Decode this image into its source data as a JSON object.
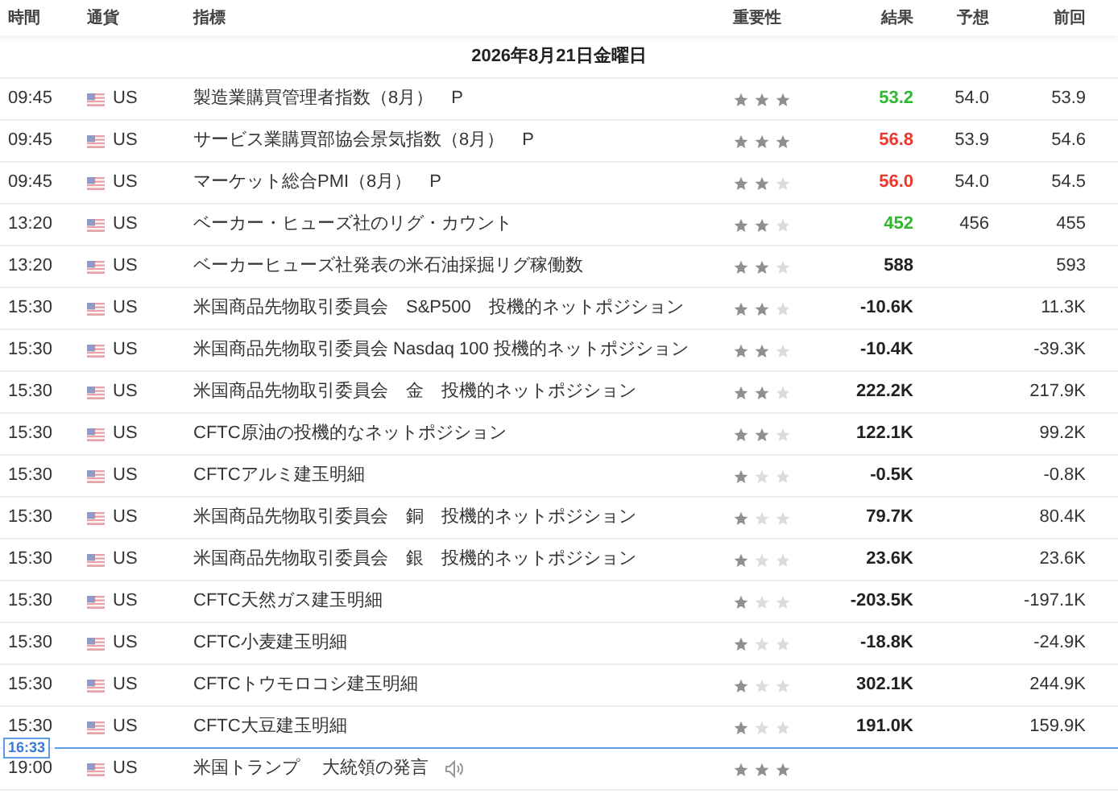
{
  "columns": [
    "時間",
    "通貨",
    "指標",
    "重要性",
    "結果",
    "予想",
    "前回"
  ],
  "date_heading": "2026年8月21日金曜日",
  "rows": [
    {
      "kind": "event",
      "time": "09:45",
      "currency": "US",
      "indicator": "製造業購買管理者指数（8月）　P",
      "stars": 3,
      "actual": "53.2",
      "color": "#2eb82e",
      "forecast": "54.0",
      "previous": "53.9",
      "speech": false
    },
    {
      "kind": "event",
      "time": "09:45",
      "currency": "US",
      "indicator": "サービス業購買部協会景気指数（8月）　P",
      "stars": 3,
      "actual": "56.8",
      "color": "#f0352b",
      "forecast": "53.9",
      "previous": "54.6",
      "speech": false
    },
    {
      "kind": "event",
      "time": "09:45",
      "currency": "US",
      "indicator": "マーケット総合PMI（8月）　P",
      "stars": 2,
      "actual": "56.0",
      "color": "#f0352b",
      "forecast": "54.0",
      "previous": "54.5",
      "speech": false
    },
    {
      "kind": "event",
      "time": "13:20",
      "currency": "US",
      "indicator": "ベーカー・ヒューズ社のリグ・カウント",
      "stars": 2,
      "actual": "452",
      "color": "#2eb82e",
      "forecast": "456",
      "previous": "455",
      "speech": false
    },
    {
      "kind": "event",
      "time": "13:20",
      "currency": "US",
      "indicator": "ベーカーヒューズ社発表の米石油採掘リグ稼働数",
      "stars": 2,
      "actual": "588",
      "color": "#222222",
      "previous": "593",
      "speech": false
    },
    {
      "kind": "event",
      "time": "15:30",
      "currency": "US",
      "indicator": "米国商品先物取引委員会　S&P500　投機的ネットポジション",
      "stars": 2,
      "actual": "-10.6K",
      "color": "#222222",
      "previous": "11.3K",
      "speech": false
    },
    {
      "kind": "event",
      "time": "15:30",
      "currency": "US",
      "indicator": "米国商品先物取引委員会 Nasdaq 100 投機的ネットポジション",
      "stars": 2,
      "actual": "-10.4K",
      "color": "#222222",
      "previous": "-39.3K",
      "speech": false
    },
    {
      "kind": "event",
      "time": "15:30",
      "currency": "US",
      "indicator": "米国商品先物取引委員会　金　投機的ネットポジション",
      "stars": 2,
      "actual": "222.2K",
      "color": "#222222",
      "previous": "217.9K",
      "speech": false
    },
    {
      "kind": "event",
      "time": "15:30",
      "currency": "US",
      "indicator": "CFTC原油の投機的なネットポジション",
      "stars": 2,
      "actual": "122.1K",
      "color": "#222222",
      "previous": "99.2K",
      "speech": false
    },
    {
      "kind": "event",
      "time": "15:30",
      "currency": "US",
      "indicator": "CFTCアルミ建玉明細",
      "stars": 1,
      "actual": "-0.5K",
      "color": "#222222",
      "previous": "-0.8K",
      "speech": false
    },
    {
      "kind": "event",
      "time": "15:30",
      "currency": "US",
      "indicator": "米国商品先物取引委員会　銅　投機的ネットポジション",
      "stars": 1,
      "actual": "79.7K",
      "color": "#222222",
      "previous": "80.4K",
      "speech": false
    },
    {
      "kind": "event",
      "time": "15:30",
      "currency": "US",
      "indicator": "米国商品先物取引委員会　銀　投機的ネットポジション",
      "stars": 1,
      "actual": "23.6K",
      "color": "#222222",
      "previous": "23.6K",
      "speech": false
    },
    {
      "kind": "event",
      "time": "15:30",
      "currency": "US",
      "indicator": "CFTC天然ガス建玉明細",
      "stars": 1,
      "actual": "-203.5K",
      "color": "#222222",
      "previous": "-197.1K",
      "speech": false
    },
    {
      "kind": "event",
      "time": "15:30",
      "currency": "US",
      "indicator": "CFTC小麦建玉明細",
      "stars": 1,
      "actual": "-18.8K",
      "color": "#222222",
      "previous": "-24.9K",
      "speech": false
    },
    {
      "kind": "event",
      "time": "15:30",
      "currency": "US",
      "indicator": "CFTCトウモロコシ建玉明細",
      "stars": 1,
      "actual": "302.1K",
      "color": "#222222",
      "previous": "244.9K",
      "speech": false
    },
    {
      "kind": "event",
      "time": "15:30",
      "currency": "US",
      "indicator": "CFTC大豆建玉明細",
      "stars": 1,
      "actual": "191.0K",
      "color": "#222222",
      "previous": "159.9K",
      "speech": false
    },
    {
      "kind": "now",
      "time": "16:33"
    },
    {
      "kind": "event",
      "time": "19:00",
      "currency": "US",
      "indicator": "米国トランプ　 大統領の発言",
      "stars": 3,
      "speech": true
    }
  ]
}
